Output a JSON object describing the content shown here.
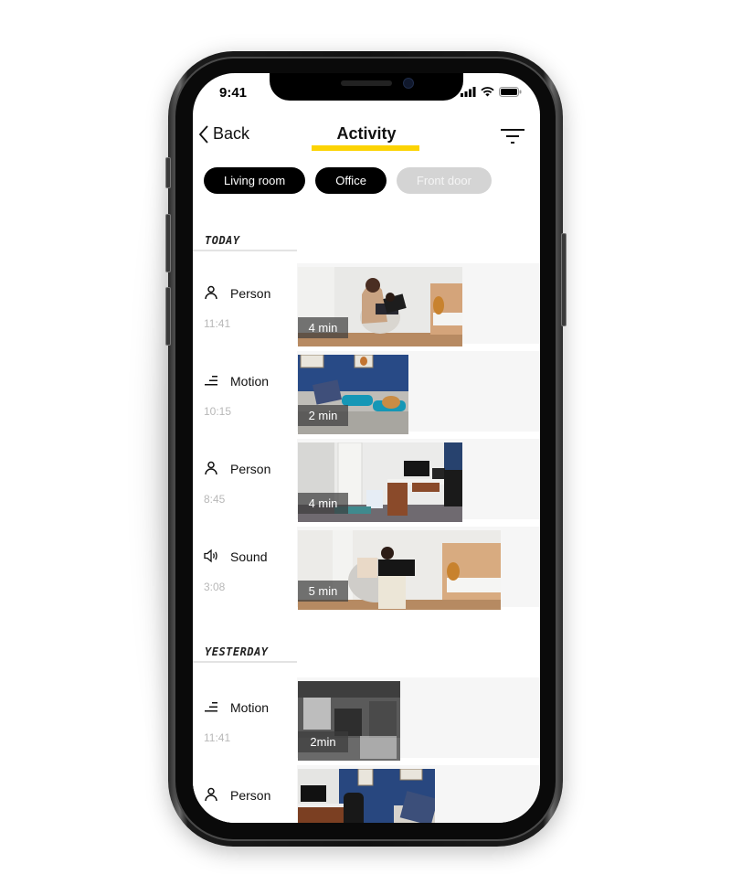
{
  "status_bar": {
    "time": "9:41",
    "icons": [
      "signal-icon",
      "wifi-icon",
      "battery-icon"
    ]
  },
  "nav": {
    "back_label": "Back",
    "back_icon": "chevron-left-icon",
    "title": "Activity",
    "accent_color": "#fcd303",
    "filter_icon": "filter-icon"
  },
  "filters": [
    {
      "label": "Living room",
      "active": true
    },
    {
      "label": "Office",
      "active": true
    },
    {
      "label": "Front door",
      "active": false
    }
  ],
  "sections": [
    {
      "heading": "TODAY",
      "events": [
        {
          "type": "Person",
          "icon": "person-icon",
          "time": "11:41",
          "duration": "4 min",
          "scene": "nursery-reading"
        },
        {
          "type": "Motion",
          "icon": "motion-icon",
          "time": "10:15",
          "duration": "2 min",
          "scene": "living-room-sofa-dog"
        },
        {
          "type": "Person",
          "icon": "person-icon",
          "time": "8:45",
          "duration": "4 min",
          "scene": "office-desk"
        },
        {
          "type": "Sound",
          "icon": "speaker-icon",
          "time": "3:08",
          "duration": "5 min",
          "scene": "nursery-child-book"
        }
      ]
    },
    {
      "heading": "YESTERDAY",
      "events": [
        {
          "type": "Motion",
          "icon": "motion-icon",
          "time": "11:41",
          "duration": "2min",
          "scene": "night-vision-kitchen"
        },
        {
          "type": "Person",
          "icon": "person-icon",
          "time": "",
          "duration": "",
          "scene": "office-living-room"
        }
      ]
    }
  ]
}
